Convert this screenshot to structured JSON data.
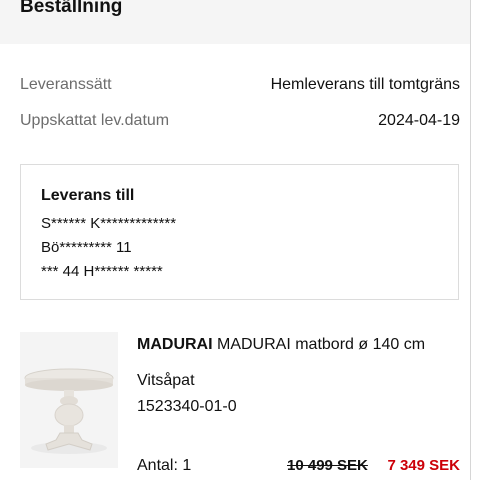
{
  "header": {
    "title": "Beställning"
  },
  "delivery": {
    "method_label": "Leveranssätt",
    "method_value": "Hemleverans till tomtgräns",
    "date_label": "Uppskattat lev.datum",
    "date_value": "2024-04-19"
  },
  "address": {
    "title": "Leverans till",
    "name": "S****** K*************",
    "street": "Bö********* 11",
    "city": "*** 44 H****** *****"
  },
  "product": {
    "brand": "MADURAI",
    "name": "MADURAI matbord ø 140 cm",
    "variant": "Vitsåpat",
    "article_number": "1523340-01-0",
    "quantity": "Antal: 1",
    "old_price": "10 499 SEK",
    "new_price": "7 349 SEK",
    "image_icon": "round-dining-table-image"
  },
  "colors": {
    "sale": "#cc0008",
    "muted": "#6d6d6d",
    "header_bg": "#f5f5f5"
  }
}
